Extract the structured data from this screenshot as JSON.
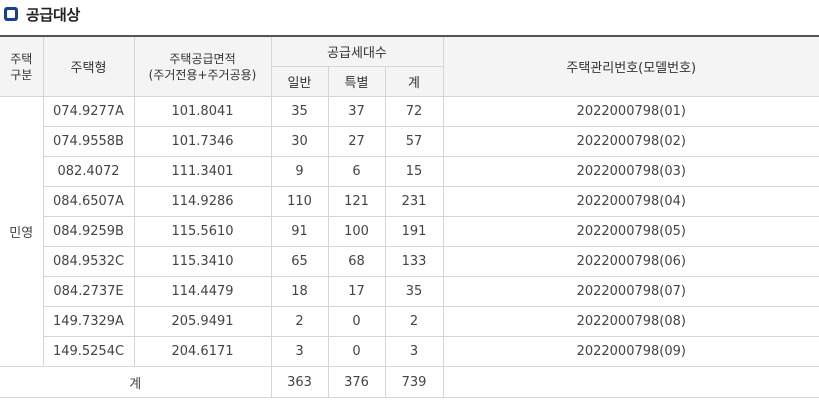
{
  "section": {
    "title": "공급대상",
    "icon": "square-bullet-icon",
    "accent_color": "#1a3f8f"
  },
  "table": {
    "headers": {
      "house_category_line1": "주택",
      "house_category_line2": "구분",
      "house_type": "주택형",
      "supply_area_line1": "주택공급면적",
      "supply_area_line2": "(주거전용+주거공용)",
      "supply_units": "공급세대수",
      "general": "일반",
      "special": "특별",
      "total": "계",
      "management_no": "주택관리번호(모델번호)"
    },
    "category": "민영",
    "rows": [
      {
        "type": "074.9277A",
        "area": "101.8041",
        "general": "35",
        "special": "37",
        "total": "72",
        "code": "2022000798(01)"
      },
      {
        "type": "074.9558B",
        "area": "101.7346",
        "general": "30",
        "special": "27",
        "total": "57",
        "code": "2022000798(02)"
      },
      {
        "type": "082.4072",
        "area": "111.3401",
        "general": "9",
        "special": "6",
        "total": "15",
        "code": "2022000798(03)"
      },
      {
        "type": "084.6507A",
        "area": "114.9286",
        "general": "110",
        "special": "121",
        "total": "231",
        "code": "2022000798(04)"
      },
      {
        "type": "084.9259B",
        "area": "115.5610",
        "general": "91",
        "special": "100",
        "total": "191",
        "code": "2022000798(05)"
      },
      {
        "type": "084.9532C",
        "area": "115.3410",
        "general": "65",
        "special": "68",
        "total": "133",
        "code": "2022000798(06)"
      },
      {
        "type": "084.2737E",
        "area": "114.4479",
        "general": "18",
        "special": "17",
        "total": "35",
        "code": "2022000798(07)"
      },
      {
        "type": "149.7329A",
        "area": "205.9491",
        "general": "2",
        "special": "0",
        "total": "2",
        "code": "2022000798(08)"
      },
      {
        "type": "149.5254C",
        "area": "204.6171",
        "general": "3",
        "special": "0",
        "total": "3",
        "code": "2022000798(09)"
      }
    ],
    "sum": {
      "label": "계",
      "general": "363",
      "special": "376",
      "total": "739"
    }
  }
}
